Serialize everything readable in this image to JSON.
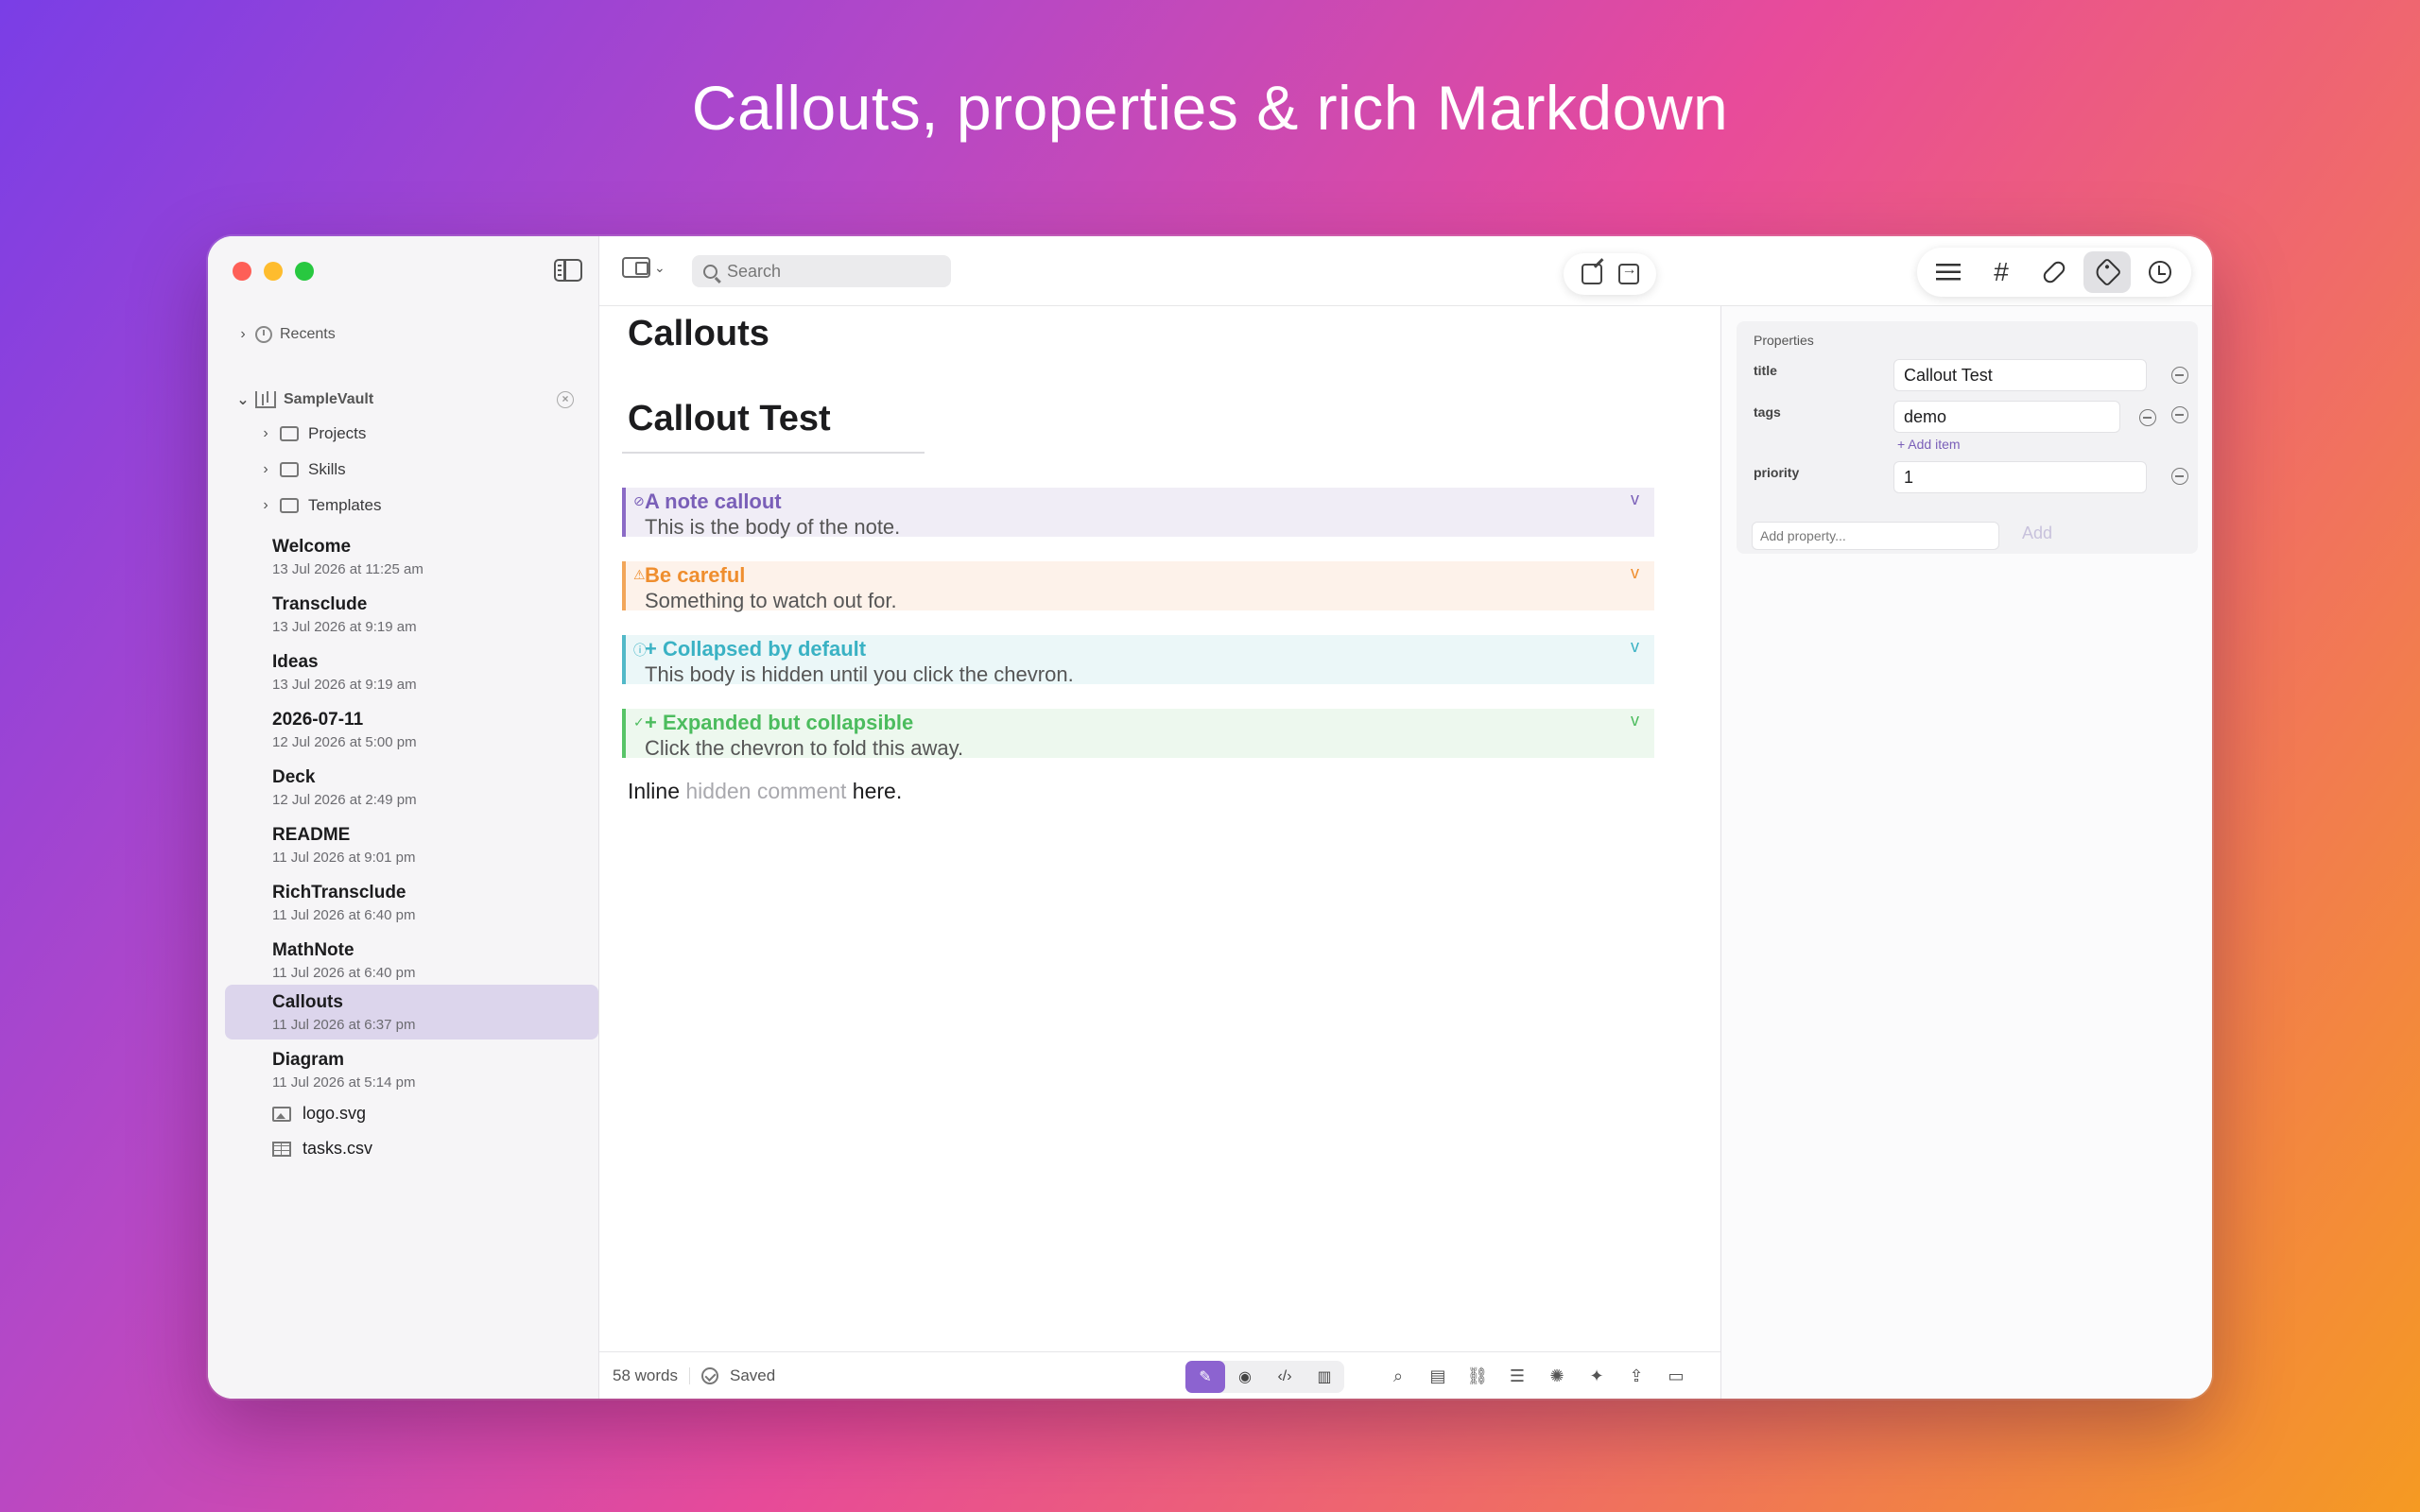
{
  "headline": "Callouts, properties & rich Markdown",
  "sidebar": {
    "recents_label": "Recents",
    "vault_name": "SampleVault",
    "folders": [
      {
        "label": "Projects"
      },
      {
        "label": "Skills"
      },
      {
        "label": "Templates"
      }
    ],
    "notes": [
      {
        "title": "Welcome",
        "date": "13 Jul 2026 at 11:25 am"
      },
      {
        "title": "Transclude",
        "date": "13 Jul 2026 at 9:19 am"
      },
      {
        "title": "Ideas",
        "date": "13 Jul 2026 at 9:19 am"
      },
      {
        "title": "2026-07-11",
        "date": "12 Jul 2026 at 5:00 pm"
      },
      {
        "title": "Deck",
        "date": "12 Jul 2026 at 2:49 pm"
      },
      {
        "title": "README",
        "date": "11 Jul 2026 at 9:01 pm"
      },
      {
        "title": "RichTransclude",
        "date": "11 Jul 2026 at 6:40 pm"
      },
      {
        "title": "MathNote",
        "date": "11 Jul 2026 at 6:40 pm"
      },
      {
        "title": "Callouts",
        "date": "11 Jul 2026 at 6:37 pm"
      },
      {
        "title": "Diagram",
        "date": "11 Jul 2026 at 5:14 pm"
      }
    ],
    "files": [
      {
        "label": "logo.svg",
        "icon": "image-file-icon"
      },
      {
        "label": "tasks.csv",
        "icon": "table-file-icon"
      }
    ],
    "selected_note": "Callouts"
  },
  "toolbar": {
    "search_placeholder": "Search",
    "right_buttons": [
      "outline-icon",
      "tags-icon",
      "links-icon",
      "properties-icon",
      "history-icon"
    ],
    "hash_glyph": "#"
  },
  "editor": {
    "h1": "Callouts",
    "h2": "Callout Test",
    "callouts": [
      {
        "type": "note",
        "title": "A note callout",
        "body": "This is the body of the note.",
        "icon": "pencil-icon",
        "color": "#7a5fb8"
      },
      {
        "type": "warning",
        "title": "Be careful",
        "body": "Something to watch out for.",
        "icon": "warning-icon",
        "color": "#ef8e2e"
      },
      {
        "type": "info",
        "title": "+ Collapsed by default",
        "body": "This body is hidden until you click the chevron.",
        "icon": "info-icon",
        "color": "#3ab2c4"
      },
      {
        "type": "success",
        "title": "+ Expanded but collapsible",
        "body": "Click the chevron to fold this away.",
        "icon": "check-icon",
        "color": "#4cbc5e"
      }
    ],
    "chevron_glyph": "v",
    "inline_prefix": "Inline ",
    "inline_hidden": "hidden comment",
    "inline_suffix": " here."
  },
  "statusbar": {
    "word_count": "58 words",
    "saved_label": "Saved"
  },
  "properties": {
    "header": "Properties",
    "title_label": "title",
    "title_value": "Callout Test",
    "tags_label": "tags",
    "tags_value": "demo",
    "add_item_label": "+ Add item",
    "priority_label": "priority",
    "priority_value": "1",
    "add_property_placeholder": "Add property...",
    "add_button_label": "Add"
  },
  "colors": {
    "accent": "#8c63d0",
    "selected_row": "#dcd5ec"
  }
}
